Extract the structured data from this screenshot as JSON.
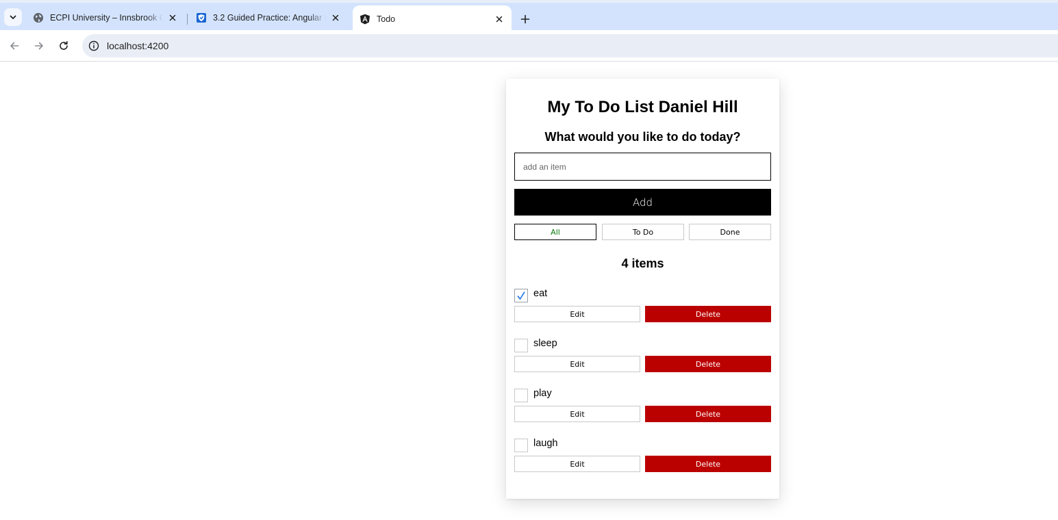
{
  "browser": {
    "tabs": [
      {
        "title": "ECPI University – Innsbrook Campus",
        "favicon": "globe-icon",
        "active": false
      },
      {
        "title": "3.2 Guided Practice: Angular Intro",
        "favicon": "shield-logo-icon",
        "active": false
      },
      {
        "title": "Todo",
        "favicon": "angular-logo-icon",
        "active": true
      }
    ],
    "url": "localhost:4200"
  },
  "app": {
    "title": "My To Do List Daniel Hill",
    "prompt": "What would you like to do today?",
    "input_placeholder": "add an item",
    "add_label": "Add",
    "filters": [
      {
        "label": "All",
        "active": true
      },
      {
        "label": "To Do",
        "active": false
      },
      {
        "label": "Done",
        "active": false
      }
    ],
    "count_label": "4 items",
    "items": [
      {
        "label": "eat",
        "done": true,
        "edit_label": "Edit",
        "delete_label": "Delete"
      },
      {
        "label": "sleep",
        "done": false,
        "edit_label": "Edit",
        "delete_label": "Delete"
      },
      {
        "label": "play",
        "done": false,
        "edit_label": "Edit",
        "delete_label": "Delete"
      },
      {
        "label": "laugh",
        "done": false,
        "edit_label": "Edit",
        "delete_label": "Delete"
      }
    ],
    "colors": {
      "accent": "#000000",
      "delete": "#bb0000",
      "active_filter_text": "#0a7a0a",
      "check": "#1a73e8"
    }
  }
}
